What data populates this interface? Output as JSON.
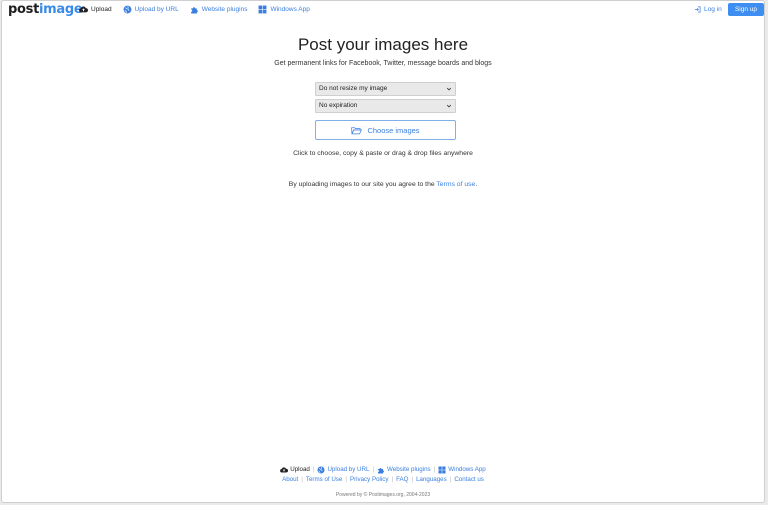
{
  "header": {
    "logo_a": "post",
    "logo_b": "image",
    "nav": [
      {
        "label": "Upload",
        "icon": "cloud-upload-icon",
        "active": true
      },
      {
        "label": "Upload by URL",
        "icon": "globe-icon"
      },
      {
        "label": "Website plugins",
        "icon": "puzzle-icon"
      },
      {
        "label": "Windows App",
        "icon": "windows-icon"
      }
    ],
    "login_label": "Log in",
    "signup_label": "Sign up"
  },
  "main": {
    "title": "Post your images here",
    "subtitle": "Get permanent links for Facebook, Twitter, message boards and blogs",
    "resize_select": "Do not resize my image",
    "expiration_select": "No expiration",
    "choose_label": "Choose images",
    "hint": "Click to choose, copy & paste or drag & drop files anywhere",
    "terms_prefix": "By uploading images to our site you agree to the ",
    "terms_link": "Terms of use",
    "terms_suffix": "."
  },
  "footer": {
    "nav": [
      {
        "label": "Upload",
        "icon": "cloud-upload-icon"
      },
      {
        "label": "Upload by URL",
        "icon": "globe-icon"
      },
      {
        "label": "Website plugins",
        "icon": "puzzle-icon"
      },
      {
        "label": "Windows App",
        "icon": "windows-icon"
      }
    ],
    "links": [
      "About",
      "Terms of Use",
      "Privacy Policy",
      "FAQ",
      "Languages",
      "Contact us"
    ],
    "copyright": "Powered by © Postimages.org, 2004-2023"
  },
  "colors": {
    "accent": "#3d8ef0",
    "link": "#3a7fe0"
  }
}
